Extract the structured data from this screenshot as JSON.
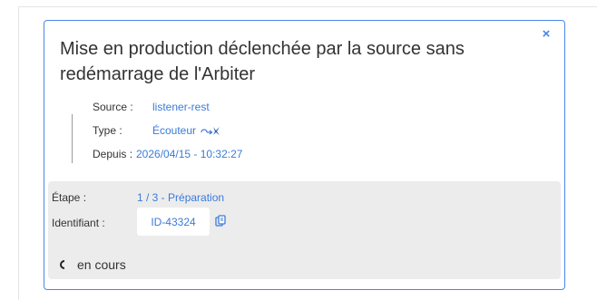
{
  "card": {
    "title": "Mise en production déclenchée par la source sans redémarrage de l'Arbiter",
    "close_symbol": "×"
  },
  "details": {
    "source_label": "Source :",
    "source_value": "listener-rest",
    "type_label": "Type :",
    "type_value": "Écouteur",
    "type_icon": "listener-icon",
    "since_label": "Depuis :",
    "since_value": "2026/04/15 - 10:32:27"
  },
  "panel": {
    "step_label": "Étape :",
    "step_value": "1 / 3 - Préparation",
    "id_label": "Identifiant :",
    "id_value": "ID-43324",
    "copy_icon": "copy-icon",
    "status_icon": "spinner-icon",
    "status_text": "en cours"
  },
  "colors": {
    "accent": "#4a86e8",
    "link": "#3b7bd9",
    "panel_bg": "#ececec",
    "text": "#333333"
  }
}
